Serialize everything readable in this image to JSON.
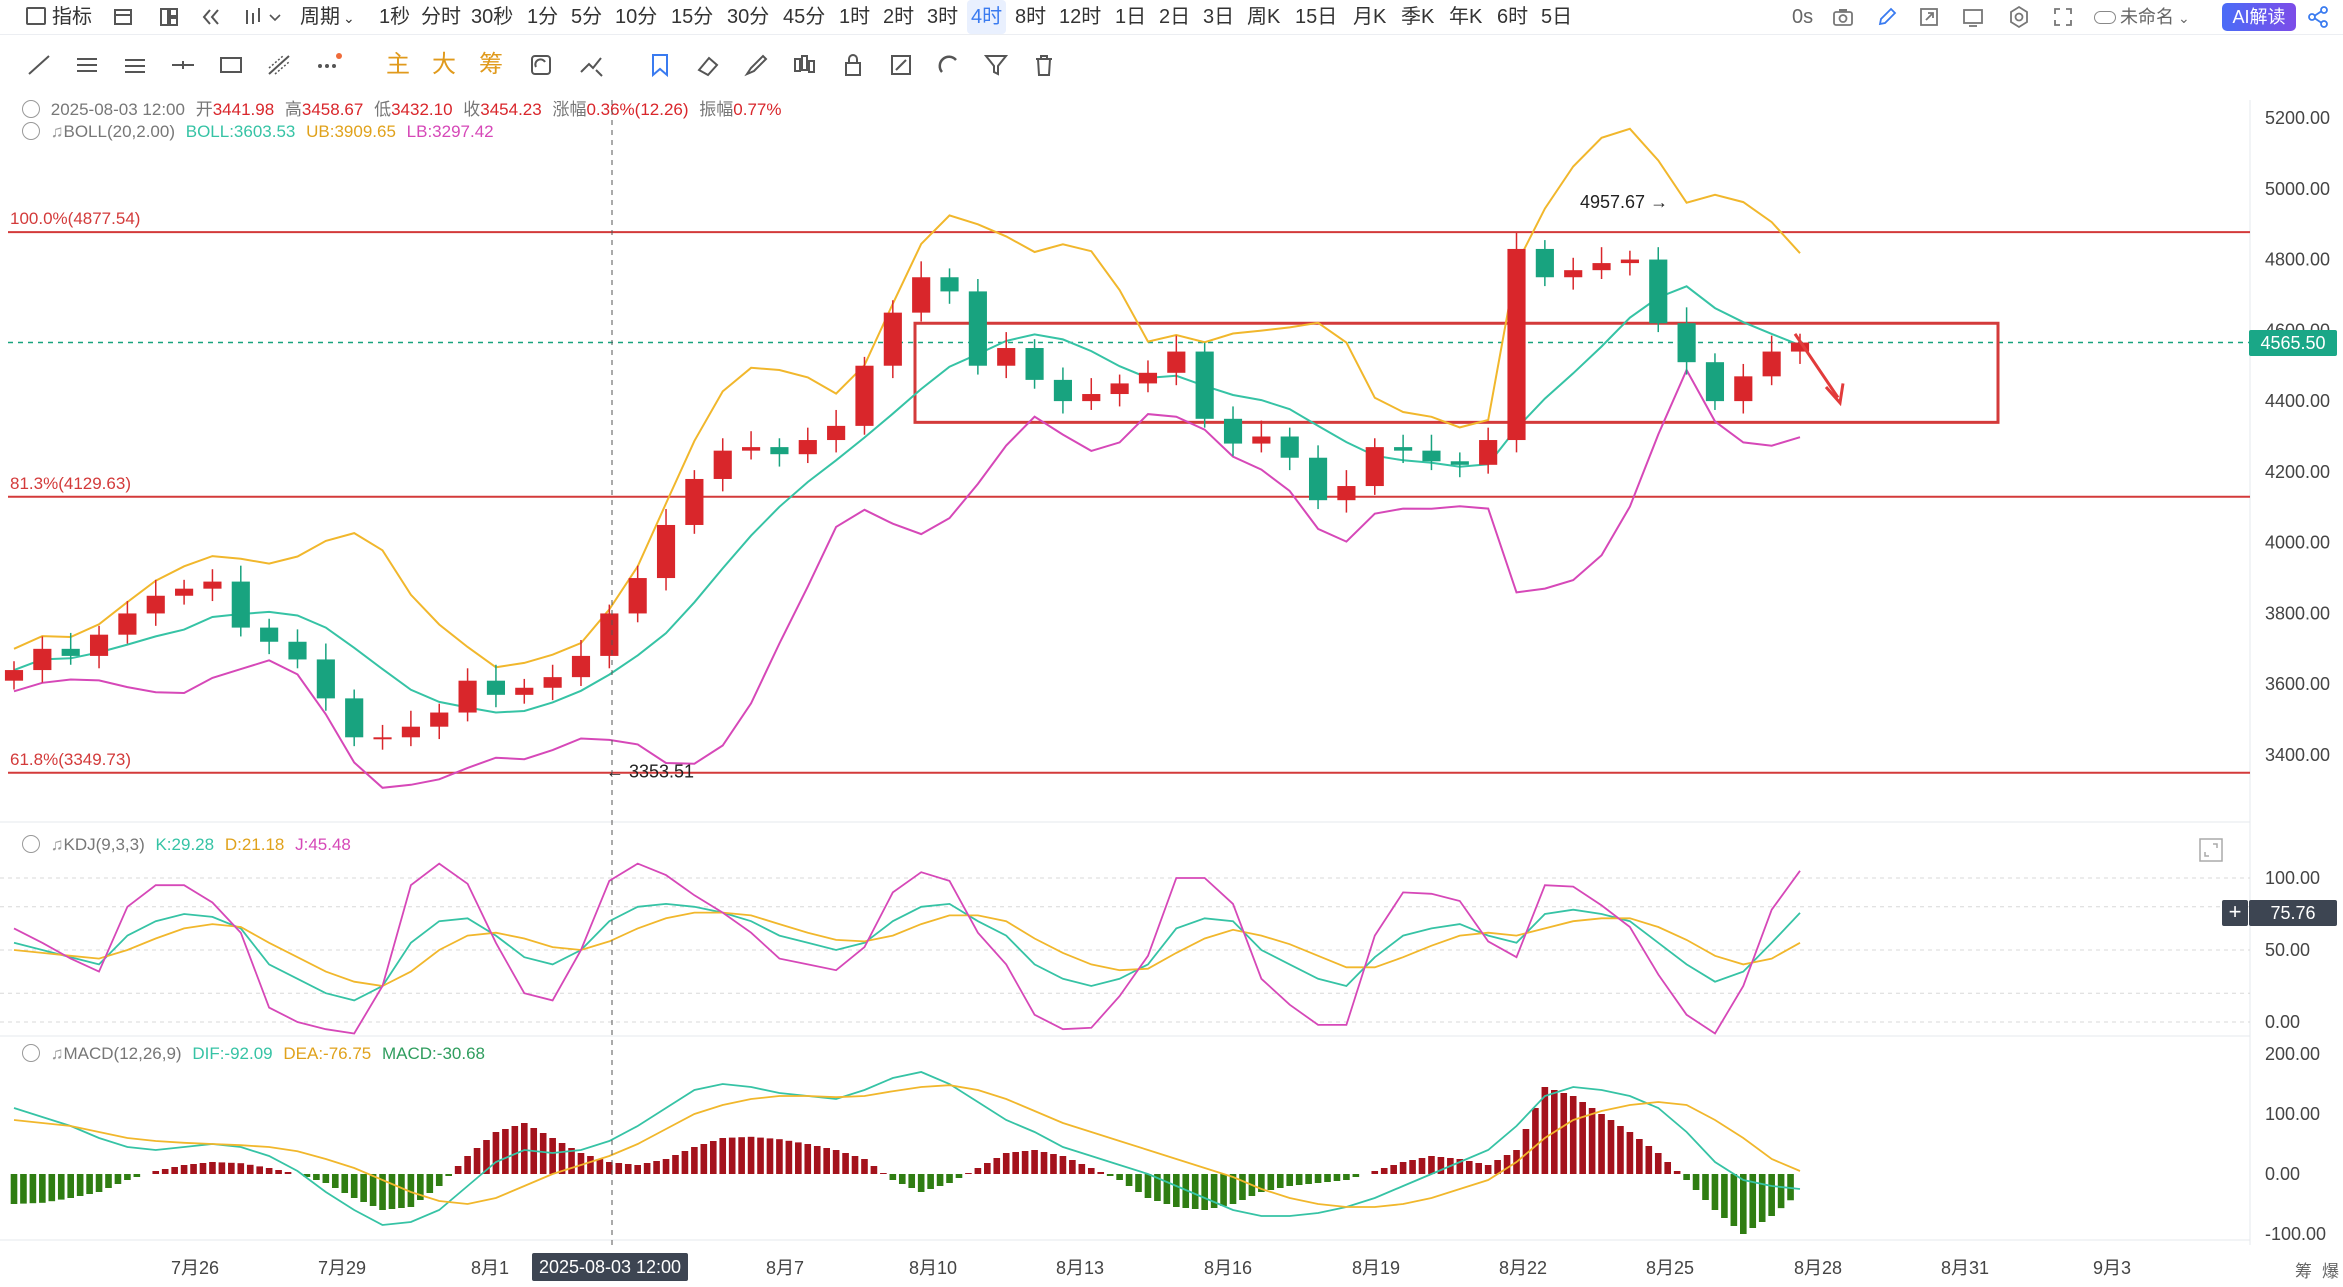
{
  "topbar": {
    "indicator_label": "指标",
    "period_label": "周期",
    "periods": [
      "1秒",
      "分时",
      "30秒",
      "1分",
      "5分",
      "10分",
      "15分",
      "30分",
      "45分",
      "1时",
      "2时",
      "3时",
      "4时",
      "8时",
      "12时",
      "1日",
      "2日",
      "3日",
      "周K",
      "15日",
      "月K",
      "季K",
      "年K",
      "6时",
      "5日"
    ],
    "active_period": "4时",
    "countdown": "0s",
    "layout_name": "未命名",
    "ai_label": "AI解读"
  },
  "colors": {
    "up": "#d9262b",
    "down": "#18a37f",
    "boll_mid": "#36c3a5",
    "boll_upper": "#f1b72c",
    "boll_lower": "#d648b8",
    "fib_line": "#d33a3a",
    "macd_pos": "#a4121c",
    "macd_neg": "#2f7d12",
    "accent": "#3a7bf0"
  },
  "legend": {
    "ohlc": {
      "date": "2025-08-03 12:00",
      "open_label": "开",
      "open": "3441.98",
      "high_label": "高",
      "high": "3458.67",
      "low_label": "低",
      "low": "3432.10",
      "close_label": "收",
      "close": "3454.23",
      "chg_label": "涨幅",
      "chg": "0.36%(12.26)",
      "amp_label": "振幅",
      "amp": "0.77%"
    },
    "boll": {
      "name": "BOLL(20,2.00)",
      "mid": "BOLL:3603.53",
      "ub": "UB:3909.65",
      "lb": "LB:3297.42"
    },
    "kdj": {
      "name": "KDJ(9,3,3)",
      "k": "K:29.28",
      "d": "D:21.18",
      "j": "J:45.48"
    },
    "macd": {
      "name": "MACD(12,26,9)",
      "dif": "DIF:-92.09",
      "dea": "DEA:-76.75",
      "macd": "MACD:-30.68"
    }
  },
  "annotations": {
    "fib_100": "100.0%(4877.54)",
    "fib_813": "81.3%(4129.63)",
    "fib_618": "61.8%(3349.73)",
    "high_marker": "4957.67",
    "low_marker": "3353.51",
    "current_price": "4565.50",
    "kdj_value": "75.76",
    "crosshair_time": "2025-08-03 12:00",
    "footer_a": "筹",
    "footer_b": "爆"
  },
  "chart_data": [
    {
      "type": "candlestick",
      "title": "",
      "x": [
        "7月26",
        "7月29",
        "8月1",
        "8月4",
        "8月7",
        "8月10",
        "8月13",
        "8月16",
        "8月19",
        "8月22",
        "8月25",
        "8月28",
        "8月31",
        "9月3"
      ],
      "ylim": [
        3250,
        5300
      ],
      "yticks": [
        3400,
        3600,
        3800,
        4000,
        4200,
        4400,
        4600,
        4800,
        5000,
        5200
      ],
      "period": "4时",
      "series": [
        {
          "name": "Close",
          "values": [
            3640,
            3700,
            3680,
            3740,
            3800,
            3850,
            3870,
            3890,
            3760,
            3720,
            3670,
            3560,
            3450,
            3450,
            3480,
            3520,
            3610,
            3570,
            3590,
            3620,
            3680,
            3800,
            3900,
            4050,
            4180,
            4260,
            4270,
            4250,
            4290,
            4330,
            4500,
            4650,
            4750,
            4710,
            4500,
            4550,
            4460,
            4400,
            4420,
            4450,
            4480,
            4540,
            4350,
            4280,
            4300,
            4240,
            4120,
            4160,
            4270,
            4260,
            4230,
            4220,
            4290,
            4830,
            4750,
            4770,
            4790,
            4800,
            4620,
            4510,
            4400,
            4470,
            4540,
            4565.5
          ]
        }
      ],
      "grid": false,
      "legend_position": "top-left"
    },
    {
      "type": "line",
      "title": "",
      "ylim": [
        0,
        110
      ],
      "yticks": [
        0,
        50,
        100
      ],
      "series": [
        {
          "name": "K",
          "values": [
            55,
            50,
            45,
            40,
            60,
            70,
            75,
            73,
            65,
            40,
            30,
            20,
            15,
            25,
            55,
            70,
            72,
            60,
            45,
            40,
            50,
            70,
            80,
            82,
            80,
            76,
            70,
            60,
            55,
            50,
            55,
            70,
            80,
            82,
            70,
            60,
            40,
            30,
            25,
            30,
            40,
            65,
            72,
            70,
            50,
            40,
            30,
            25,
            45,
            60,
            65,
            68,
            60,
            55,
            75,
            78,
            75,
            70,
            55,
            40,
            28,
            35,
            55,
            75.76
          ]
        },
        {
          "name": "D",
          "values": [
            50,
            48,
            46,
            44,
            50,
            58,
            65,
            68,
            66,
            55,
            45,
            35,
            28,
            25,
            35,
            50,
            60,
            62,
            58,
            52,
            50,
            56,
            65,
            72,
            76,
            76,
            74,
            68,
            62,
            57,
            56,
            60,
            68,
            74,
            74,
            70,
            58,
            48,
            40,
            36,
            37,
            48,
            58,
            64,
            60,
            54,
            46,
            38,
            38,
            45,
            53,
            60,
            62,
            60,
            65,
            70,
            72,
            72,
            66,
            57,
            46,
            40,
            44,
            55
          ]
        },
        {
          "name": "J",
          "values": [
            65,
            55,
            44,
            35,
            80,
            95,
            95,
            83,
            62,
            10,
            0,
            -5,
            -10,
            25,
            95,
            110,
            96,
            55,
            20,
            15,
            50,
            98,
            110,
            102,
            88,
            76,
            62,
            44,
            40,
            36,
            52,
            90,
            104,
            98,
            62,
            40,
            5,
            -5,
            -4,
            18,
            46,
            100,
            100,
            82,
            30,
            12,
            -2,
            -2,
            60,
            90,
            89,
            84,
            56,
            45,
            95,
            94,
            81,
            66,
            33,
            5,
            -8,
            25,
            78,
            105
          ]
        }
      ],
      "grid": false,
      "legend_position": "top-left"
    },
    {
      "type": "bar",
      "title": "",
      "ylim": [
        -115,
        215
      ],
      "yticks": [
        -100,
        0,
        100,
        200
      ],
      "series": [
        {
          "name": "MACD",
          "values": [
            -50,
            -48,
            -40,
            -30,
            -10,
            5,
            15,
            20,
            18,
            10,
            0,
            -15,
            -40,
            -60,
            -55,
            -20,
            30,
            70,
            85,
            60,
            35,
            20,
            15,
            25,
            45,
            60,
            62,
            58,
            50,
            40,
            25,
            -10,
            -30,
            -15,
            10,
            35,
            40,
            30,
            10,
            -10,
            -40,
            -55,
            -60,
            -50,
            -30,
            -20,
            -15,
            -10,
            5,
            20,
            30,
            25,
            15,
            40,
            145,
            130,
            100,
            70,
            35,
            -10,
            -60,
            -100,
            -70,
            -30.68
          ]
        },
        {
          "name": "DIF",
          "values": [
            110,
            95,
            80,
            60,
            45,
            40,
            45,
            50,
            45,
            30,
            5,
            -30,
            -60,
            -85,
            -80,
            -60,
            -20,
            20,
            40,
            35,
            40,
            55,
            80,
            110,
            140,
            150,
            145,
            135,
            130,
            125,
            140,
            160,
            170,
            150,
            120,
            90,
            70,
            45,
            30,
            15,
            0,
            -20,
            -40,
            -60,
            -70,
            -70,
            -65,
            -55,
            -40,
            -20,
            0,
            20,
            40,
            80,
            130,
            145,
            140,
            130,
            110,
            70,
            20,
            -10,
            -20,
            -25
          ]
        },
        {
          "name": "DEA",
          "values": [
            90,
            85,
            80,
            70,
            60,
            55,
            52,
            50,
            48,
            45,
            38,
            25,
            10,
            -10,
            -30,
            -45,
            -50,
            -40,
            -20,
            0,
            15,
            30,
            50,
            75,
            100,
            115,
            125,
            130,
            130,
            128,
            130,
            138,
            145,
            148,
            140,
            125,
            105,
            85,
            70,
            55,
            40,
            25,
            10,
            -5,
            -25,
            -40,
            -50,
            -55,
            -55,
            -50,
            -40,
            -25,
            -10,
            20,
            60,
            90,
            105,
            115,
            120,
            115,
            90,
            60,
            25,
            5
          ]
        }
      ],
      "grid": false,
      "legend_position": "top-left"
    }
  ]
}
